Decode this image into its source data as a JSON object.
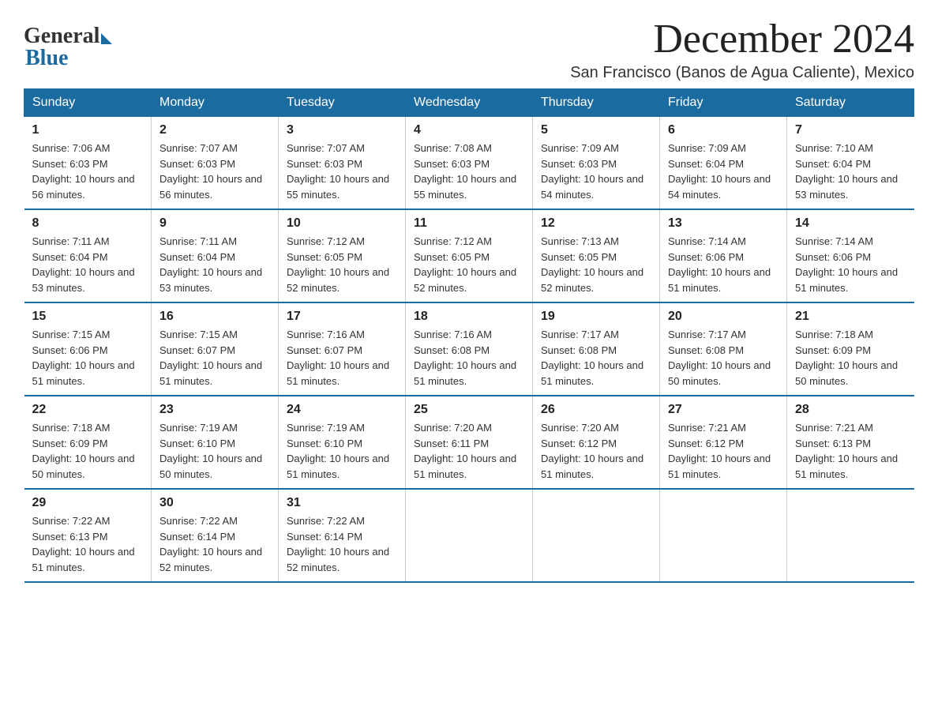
{
  "logo": {
    "general": "General",
    "blue": "Blue"
  },
  "title": "December 2024",
  "subtitle": "San Francisco (Banos de Agua Caliente), Mexico",
  "days_of_week": [
    "Sunday",
    "Monday",
    "Tuesday",
    "Wednesday",
    "Thursday",
    "Friday",
    "Saturday"
  ],
  "weeks": [
    [
      {
        "day": "1",
        "sunrise": "Sunrise: 7:06 AM",
        "sunset": "Sunset: 6:03 PM",
        "daylight": "Daylight: 10 hours and 56 minutes."
      },
      {
        "day": "2",
        "sunrise": "Sunrise: 7:07 AM",
        "sunset": "Sunset: 6:03 PM",
        "daylight": "Daylight: 10 hours and 56 minutes."
      },
      {
        "day": "3",
        "sunrise": "Sunrise: 7:07 AM",
        "sunset": "Sunset: 6:03 PM",
        "daylight": "Daylight: 10 hours and 55 minutes."
      },
      {
        "day": "4",
        "sunrise": "Sunrise: 7:08 AM",
        "sunset": "Sunset: 6:03 PM",
        "daylight": "Daylight: 10 hours and 55 minutes."
      },
      {
        "day": "5",
        "sunrise": "Sunrise: 7:09 AM",
        "sunset": "Sunset: 6:03 PM",
        "daylight": "Daylight: 10 hours and 54 minutes."
      },
      {
        "day": "6",
        "sunrise": "Sunrise: 7:09 AM",
        "sunset": "Sunset: 6:04 PM",
        "daylight": "Daylight: 10 hours and 54 minutes."
      },
      {
        "day": "7",
        "sunrise": "Sunrise: 7:10 AM",
        "sunset": "Sunset: 6:04 PM",
        "daylight": "Daylight: 10 hours and 53 minutes."
      }
    ],
    [
      {
        "day": "8",
        "sunrise": "Sunrise: 7:11 AM",
        "sunset": "Sunset: 6:04 PM",
        "daylight": "Daylight: 10 hours and 53 minutes."
      },
      {
        "day": "9",
        "sunrise": "Sunrise: 7:11 AM",
        "sunset": "Sunset: 6:04 PM",
        "daylight": "Daylight: 10 hours and 53 minutes."
      },
      {
        "day": "10",
        "sunrise": "Sunrise: 7:12 AM",
        "sunset": "Sunset: 6:05 PM",
        "daylight": "Daylight: 10 hours and 52 minutes."
      },
      {
        "day": "11",
        "sunrise": "Sunrise: 7:12 AM",
        "sunset": "Sunset: 6:05 PM",
        "daylight": "Daylight: 10 hours and 52 minutes."
      },
      {
        "day": "12",
        "sunrise": "Sunrise: 7:13 AM",
        "sunset": "Sunset: 6:05 PM",
        "daylight": "Daylight: 10 hours and 52 minutes."
      },
      {
        "day": "13",
        "sunrise": "Sunrise: 7:14 AM",
        "sunset": "Sunset: 6:06 PM",
        "daylight": "Daylight: 10 hours and 51 minutes."
      },
      {
        "day": "14",
        "sunrise": "Sunrise: 7:14 AM",
        "sunset": "Sunset: 6:06 PM",
        "daylight": "Daylight: 10 hours and 51 minutes."
      }
    ],
    [
      {
        "day": "15",
        "sunrise": "Sunrise: 7:15 AM",
        "sunset": "Sunset: 6:06 PM",
        "daylight": "Daylight: 10 hours and 51 minutes."
      },
      {
        "day": "16",
        "sunrise": "Sunrise: 7:15 AM",
        "sunset": "Sunset: 6:07 PM",
        "daylight": "Daylight: 10 hours and 51 minutes."
      },
      {
        "day": "17",
        "sunrise": "Sunrise: 7:16 AM",
        "sunset": "Sunset: 6:07 PM",
        "daylight": "Daylight: 10 hours and 51 minutes."
      },
      {
        "day": "18",
        "sunrise": "Sunrise: 7:16 AM",
        "sunset": "Sunset: 6:08 PM",
        "daylight": "Daylight: 10 hours and 51 minutes."
      },
      {
        "day": "19",
        "sunrise": "Sunrise: 7:17 AM",
        "sunset": "Sunset: 6:08 PM",
        "daylight": "Daylight: 10 hours and 51 minutes."
      },
      {
        "day": "20",
        "sunrise": "Sunrise: 7:17 AM",
        "sunset": "Sunset: 6:08 PM",
        "daylight": "Daylight: 10 hours and 50 minutes."
      },
      {
        "day": "21",
        "sunrise": "Sunrise: 7:18 AM",
        "sunset": "Sunset: 6:09 PM",
        "daylight": "Daylight: 10 hours and 50 minutes."
      }
    ],
    [
      {
        "day": "22",
        "sunrise": "Sunrise: 7:18 AM",
        "sunset": "Sunset: 6:09 PM",
        "daylight": "Daylight: 10 hours and 50 minutes."
      },
      {
        "day": "23",
        "sunrise": "Sunrise: 7:19 AM",
        "sunset": "Sunset: 6:10 PM",
        "daylight": "Daylight: 10 hours and 50 minutes."
      },
      {
        "day": "24",
        "sunrise": "Sunrise: 7:19 AM",
        "sunset": "Sunset: 6:10 PM",
        "daylight": "Daylight: 10 hours and 51 minutes."
      },
      {
        "day": "25",
        "sunrise": "Sunrise: 7:20 AM",
        "sunset": "Sunset: 6:11 PM",
        "daylight": "Daylight: 10 hours and 51 minutes."
      },
      {
        "day": "26",
        "sunrise": "Sunrise: 7:20 AM",
        "sunset": "Sunset: 6:12 PM",
        "daylight": "Daylight: 10 hours and 51 minutes."
      },
      {
        "day": "27",
        "sunrise": "Sunrise: 7:21 AM",
        "sunset": "Sunset: 6:12 PM",
        "daylight": "Daylight: 10 hours and 51 minutes."
      },
      {
        "day": "28",
        "sunrise": "Sunrise: 7:21 AM",
        "sunset": "Sunset: 6:13 PM",
        "daylight": "Daylight: 10 hours and 51 minutes."
      }
    ],
    [
      {
        "day": "29",
        "sunrise": "Sunrise: 7:22 AM",
        "sunset": "Sunset: 6:13 PM",
        "daylight": "Daylight: 10 hours and 51 minutes."
      },
      {
        "day": "30",
        "sunrise": "Sunrise: 7:22 AM",
        "sunset": "Sunset: 6:14 PM",
        "daylight": "Daylight: 10 hours and 52 minutes."
      },
      {
        "day": "31",
        "sunrise": "Sunrise: 7:22 AM",
        "sunset": "Sunset: 6:14 PM",
        "daylight": "Daylight: 10 hours and 52 minutes."
      },
      null,
      null,
      null,
      null
    ]
  ]
}
